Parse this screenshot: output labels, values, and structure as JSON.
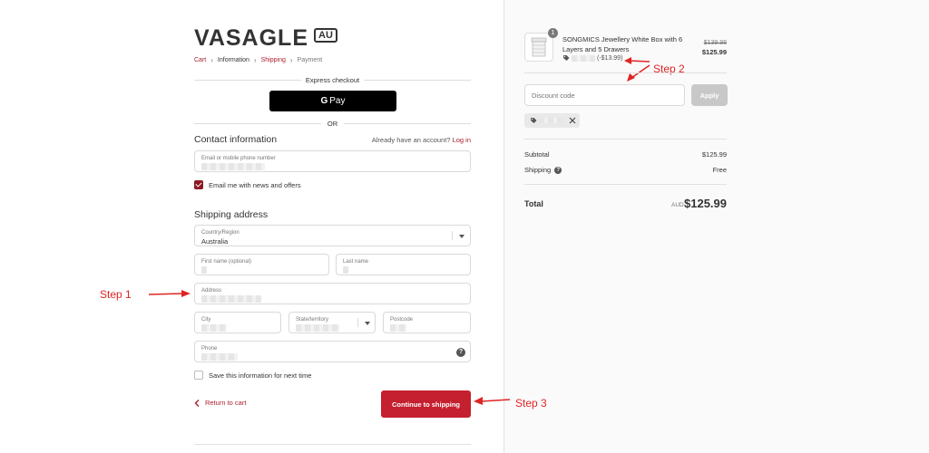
{
  "brand": {
    "name": "VASAGLE",
    "region": "AU"
  },
  "breadcrumb": [
    {
      "label": "Cart",
      "state": "link"
    },
    {
      "label": "Information",
      "state": "current"
    },
    {
      "label": "Shipping",
      "state": "link"
    },
    {
      "label": "Payment",
      "state": "muted"
    }
  ],
  "express": {
    "title": "Express checkout",
    "gpay_label": "Pay",
    "gpay_g": "G",
    "or_label": "OR"
  },
  "contact": {
    "title": "Contact information",
    "account_prompt": "Already have an account?",
    "login_label": "Log in",
    "email_label": "Email or mobile phone number",
    "newsletter_label": "Email me with news and offers",
    "newsletter_checked": true
  },
  "shipping": {
    "title": "Shipping address",
    "country_label": "Country/Region",
    "country_value": "Australia",
    "first_name_label": "First name (optional)",
    "last_name_label": "Last name",
    "address_label": "Address",
    "city_label": "City",
    "state_label": "State/territory",
    "postcode_label": "Postcode",
    "phone_label": "Phone",
    "help_glyph": "?",
    "save_label": "Save this information for next time",
    "save_checked": false
  },
  "actions": {
    "return_label": "Return to cart",
    "continue_label": "Continue to shipping"
  },
  "annotations": {
    "step1": "Step 1",
    "step2": "Step 2",
    "step3": "Step 3"
  },
  "order": {
    "item": {
      "quantity": "1",
      "name": "SONGMICS Jewellery White Box with 6 Layers and 5 Drawers",
      "discount": "(-$13.99)",
      "original_price": "$139.98",
      "price": "$125.99"
    },
    "discount_placeholder": "Discount code",
    "apply_label": "Apply",
    "subtotal_label": "Subtotal",
    "subtotal_value": "$125.99",
    "shipping_label": "Shipping",
    "shipping_value": "Free",
    "total_label": "Total",
    "currency": "AUD",
    "total_value": "$125.99"
  },
  "colors": {
    "accent": "#c4202f",
    "link": "#a91f2c",
    "annotation": "#e02424"
  }
}
